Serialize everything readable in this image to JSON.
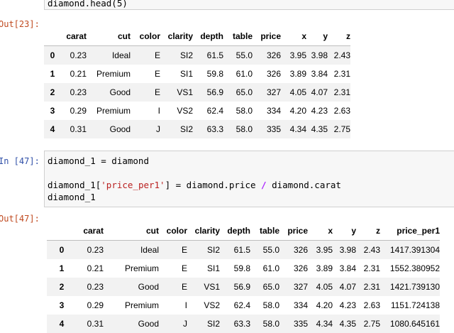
{
  "cell1": {
    "code": "diamond.head(5)",
    "out_prompt": "Out[23]:"
  },
  "table1": {
    "columns": [
      "",
      "carat",
      "cut",
      "color",
      "clarity",
      "depth",
      "table",
      "price",
      "x",
      "y",
      "z"
    ],
    "rows": [
      [
        "0",
        "0.23",
        "Ideal",
        "E",
        "SI2",
        "61.5",
        "55.0",
        "326",
        "3.95",
        "3.98",
        "2.43"
      ],
      [
        "1",
        "0.21",
        "Premium",
        "E",
        "SI1",
        "59.8",
        "61.0",
        "326",
        "3.89",
        "3.84",
        "2.31"
      ],
      [
        "2",
        "0.23",
        "Good",
        "E",
        "VS1",
        "56.9",
        "65.0",
        "327",
        "4.05",
        "4.07",
        "2.31"
      ],
      [
        "3",
        "0.29",
        "Premium",
        "I",
        "VS2",
        "62.4",
        "58.0",
        "334",
        "4.20",
        "4.23",
        "2.63"
      ],
      [
        "4",
        "0.31",
        "Good",
        "J",
        "SI2",
        "63.3",
        "58.0",
        "335",
        "4.34",
        "4.35",
        "2.75"
      ]
    ]
  },
  "cell2": {
    "in_prompt": "In [47]:",
    "line1": "diamond_1 = diamond",
    "line3_prefix": "diamond_1[",
    "line3_string": "'price_per1'",
    "line3_middle": "] = diamond.price ",
    "line3_operator": "/",
    "line3_suffix": " diamond.carat",
    "line4": "diamond_1",
    "out_prompt": "Out[47]:"
  },
  "table2": {
    "columns": [
      "",
      "carat",
      "cut",
      "color",
      "clarity",
      "depth",
      "table",
      "price",
      "x",
      "y",
      "z",
      "price_per1"
    ],
    "rows": [
      [
        "0",
        "0.23",
        "Ideal",
        "E",
        "SI2",
        "61.5",
        "55.0",
        "326",
        "3.95",
        "3.98",
        "2.43",
        "1417.391304"
      ],
      [
        "1",
        "0.21",
        "Premium",
        "E",
        "SI1",
        "59.8",
        "61.0",
        "326",
        "3.89",
        "3.84",
        "2.31",
        "1552.380952"
      ],
      [
        "2",
        "0.23",
        "Good",
        "E",
        "VS1",
        "56.9",
        "65.0",
        "327",
        "4.05",
        "4.07",
        "2.31",
        "1421.739130"
      ],
      [
        "3",
        "0.29",
        "Premium",
        "I",
        "VS2",
        "62.4",
        "58.0",
        "334",
        "4.20",
        "4.23",
        "2.63",
        "1151.724138"
      ],
      [
        "4",
        "0.31",
        "Good",
        "J",
        "SI2",
        "63.3",
        "58.0",
        "335",
        "4.34",
        "4.35",
        "2.75",
        "1080.645161"
      ]
    ]
  }
}
